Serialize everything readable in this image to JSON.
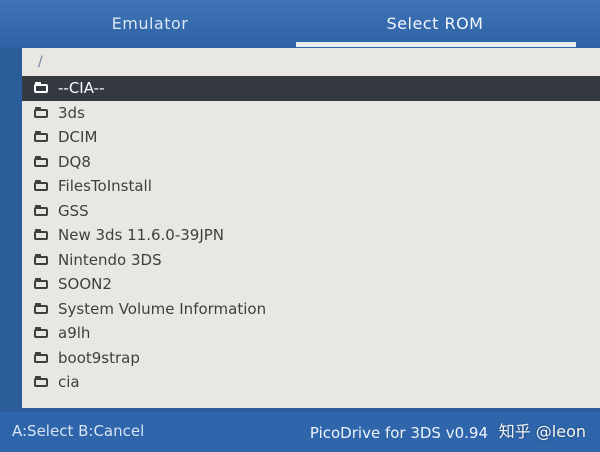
{
  "tabs": [
    {
      "label": "Emulator"
    },
    {
      "label": "Select ROM"
    }
  ],
  "path": "/",
  "files": [
    {
      "name": "--CIA--",
      "icon": "folder-icon",
      "selected": true
    },
    {
      "name": "3ds",
      "icon": "folder-icon"
    },
    {
      "name": "DCIM",
      "icon": "folder-icon"
    },
    {
      "name": "DQ8",
      "icon": "folder-icon"
    },
    {
      "name": "FilesToInstall",
      "icon": "folder-icon"
    },
    {
      "name": "GSS",
      "icon": "folder-icon"
    },
    {
      "name": "New 3ds 11.6.0-39JPN",
      "icon": "folder-icon"
    },
    {
      "name": "Nintendo 3DS",
      "icon": "folder-icon"
    },
    {
      "name": "SOON2",
      "icon": "folder-icon"
    },
    {
      "name": "System Volume Information",
      "icon": "folder-icon"
    },
    {
      "name": "a9lh",
      "icon": "folder-icon"
    },
    {
      "name": "boot9strap",
      "icon": "folder-icon"
    },
    {
      "name": "cia",
      "icon": "folder-icon"
    }
  ],
  "scroll_indicator_icon": "chevron-down-icon",
  "footer": {
    "controls_hint": "A:Select  B:Cancel",
    "app_info": "PicoDrive for 3DS v0.94",
    "watermark": "知乎 @leon"
  },
  "colors": {
    "accent": "#2e65ab",
    "panel": "#e8e7e2",
    "selected_row": "#343942"
  }
}
